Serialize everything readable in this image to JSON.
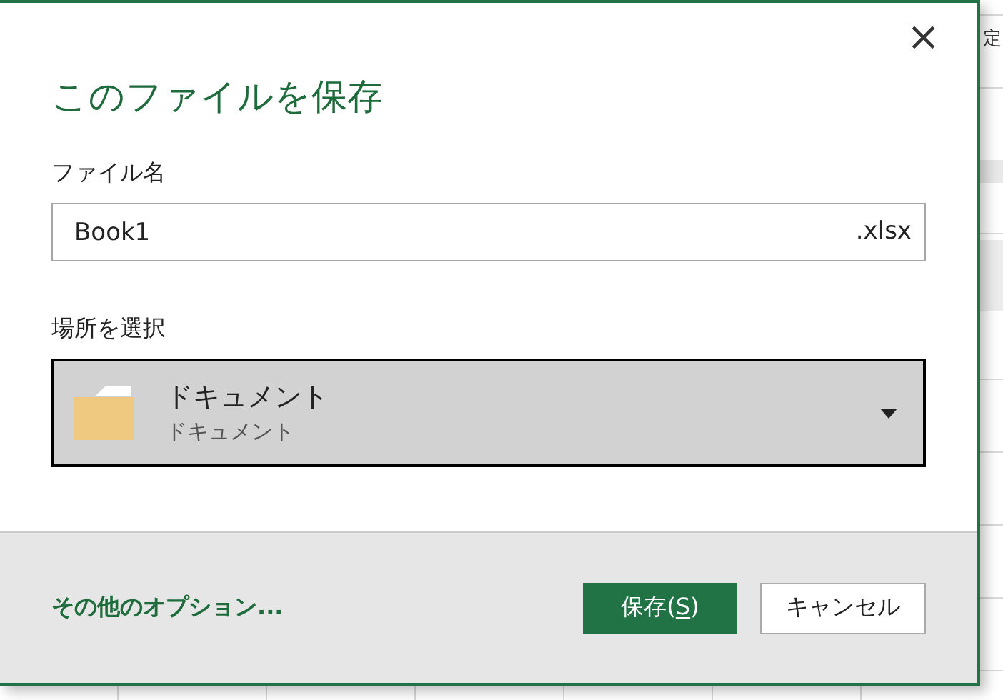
{
  "background_sheet": {
    "cell_text": "定"
  },
  "dialog": {
    "title": "このファイルを保存",
    "close": "×",
    "file_name": {
      "label": "ファイル名",
      "value": "Book1",
      "extension": ".xlsx"
    },
    "location": {
      "label": "場所を選択",
      "name": "ドキュメント",
      "path": "ドキュメント",
      "expanded": false
    },
    "more_options": "その他のオプション...",
    "buttons": [
      {
        "kind": "primary",
        "label_before": "保存(",
        "access_key": "S",
        "label_after": ")"
      },
      {
        "kind": "secondary",
        "label_before": "キャンセル"
      }
    ]
  }
}
